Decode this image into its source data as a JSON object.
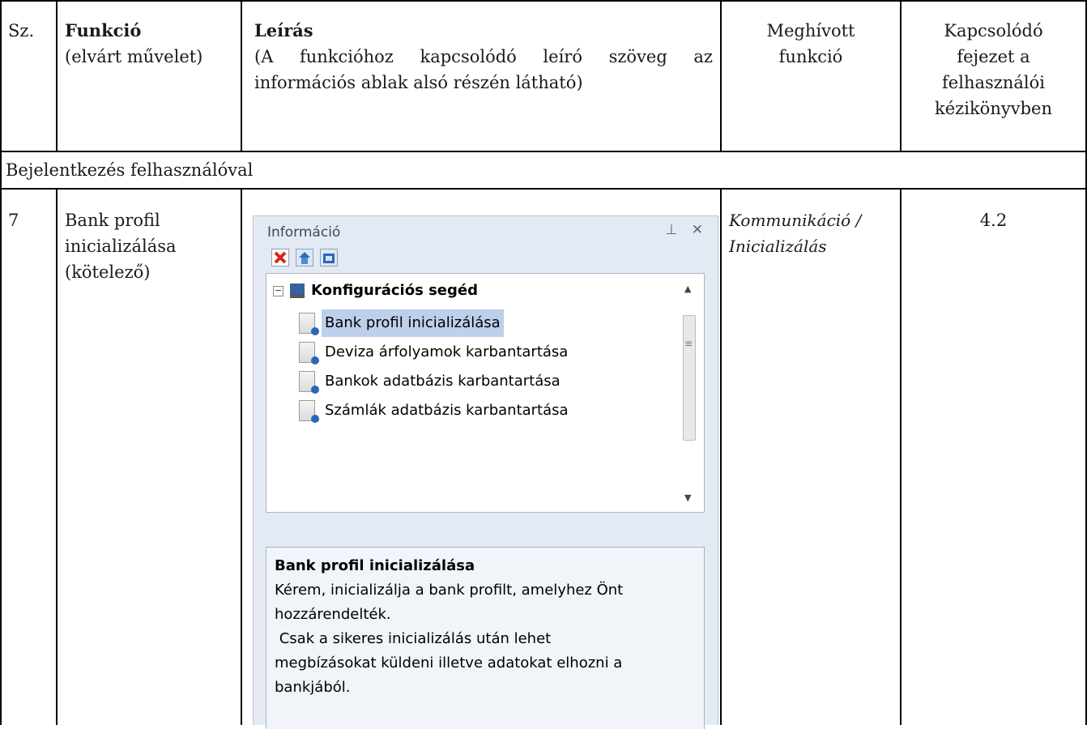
{
  "table": {
    "headers": {
      "sz": "Sz.",
      "funkcio_title": "Funkció",
      "funkcio_sub": "(elvárt művelet)",
      "leiras_title": "Leírás",
      "leiras_sub_1": "(A funkcióhoz kapcsolódó leíró szöveg az",
      "leiras_sub_2": "információs ablak alsó részén látható)",
      "meghivott_1": "Meghívott",
      "meghivott_2": "funkció",
      "kapcs_1": "Kapcsolódó",
      "kapcs_2": "fejezet a",
      "kapcs_3": "felhasználói",
      "kapcs_4": "kézikönyvben"
    },
    "section_title": "Bejelentkezés felhasználóval",
    "row": {
      "sz": "7",
      "funkcio_1": "Bank profil",
      "funkcio_2": "inicializálása",
      "funkcio_3": "(kötelező)",
      "meghivott_1": "Kommunikáció /",
      "meghivott_2": "Inicializálás",
      "fejezet": "4.2"
    }
  },
  "info_window": {
    "title": "Információ",
    "pin_glyph": "⊥",
    "close_glyph": "✕",
    "tree": {
      "root_label": "Konfigurációs segéd",
      "items": [
        {
          "label": "Bank profil inicializálása",
          "selected": true
        },
        {
          "label": "Deviza árfolyamok karbantartása",
          "selected": false
        },
        {
          "label": "Bankok adatbázis karbantartása",
          "selected": false
        },
        {
          "label": "Számlák adatbázis karbantartása",
          "selected": false
        }
      ]
    },
    "description": {
      "title": "Bank profil inicializálása",
      "line_1": "Kérem, inicializálja a bank profilt, amelyhez Önt",
      "line_2": "hozzárendelték.",
      "line_3": " Csak a sikeres inicializálás után lehet",
      "line_4": "megbízásokat küldeni illetve adatokat elhozni a",
      "line_5": "bankjából."
    }
  },
  "colors": {
    "selection": "#bcd0ec",
    "window_bg": "#e4eaf3"
  }
}
